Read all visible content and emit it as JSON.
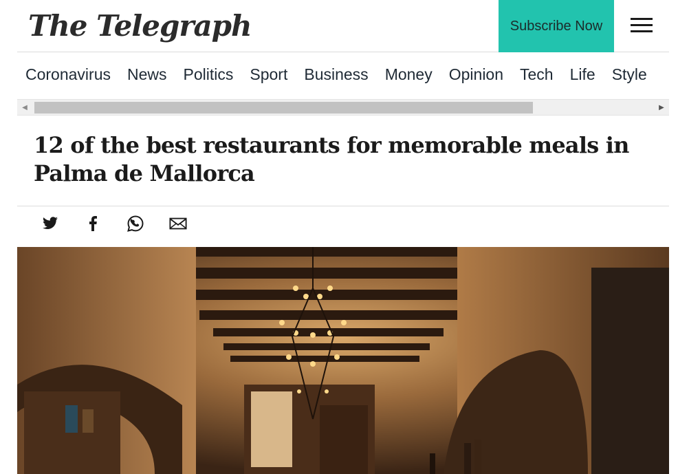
{
  "header": {
    "logo_text": "The Telegraph",
    "subscribe_label": "Subscribe Now",
    "menu_icon": "hamburger-menu-icon"
  },
  "nav": {
    "items": [
      "Coronavirus",
      "News",
      "Politics",
      "Sport",
      "Business",
      "Money",
      "Opinion",
      "Tech",
      "Life",
      "Style"
    ]
  },
  "article": {
    "headline": "12 of the best restaurants for memorable meals in Palma de Mallorca"
  },
  "share": {
    "icons": [
      "twitter-icon",
      "facebook-icon",
      "whatsapp-icon",
      "email-icon"
    ]
  },
  "colors": {
    "subscribe_bg": "#22c3ae",
    "text": "#1a1a1a"
  }
}
